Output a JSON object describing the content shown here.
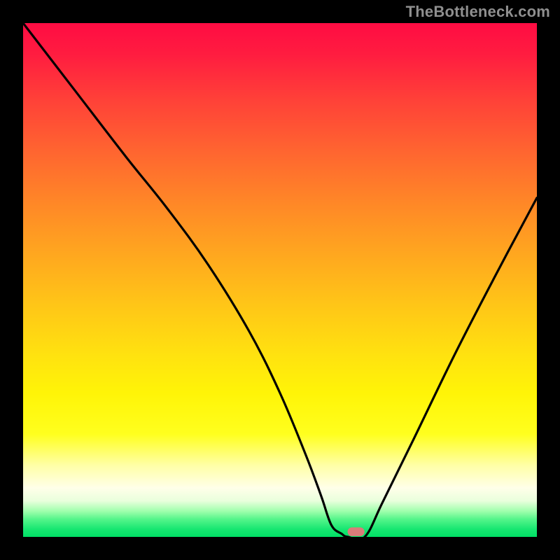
{
  "watermark": "TheBottleneck.com",
  "chart_data": {
    "type": "line",
    "title": "",
    "xlabel": "",
    "ylabel": "",
    "xlim": [
      0,
      100
    ],
    "ylim": [
      0,
      100
    ],
    "grid": false,
    "legend": false,
    "background": {
      "type": "vertical-gradient",
      "stops": [
        {
          "pos": 0.0,
          "color": "#ff0c43"
        },
        {
          "pos": 0.06,
          "color": "#ff1c40"
        },
        {
          "pos": 0.15,
          "color": "#ff4138"
        },
        {
          "pos": 0.25,
          "color": "#ff6530"
        },
        {
          "pos": 0.35,
          "color": "#ff8727"
        },
        {
          "pos": 0.45,
          "color": "#ffa71f"
        },
        {
          "pos": 0.55,
          "color": "#ffc617"
        },
        {
          "pos": 0.65,
          "color": "#ffe30f"
        },
        {
          "pos": 0.72,
          "color": "#fff407"
        },
        {
          "pos": 0.8,
          "color": "#ffff1e"
        },
        {
          "pos": 0.86,
          "color": "#ffffa5"
        },
        {
          "pos": 0.905,
          "color": "#ffffe9"
        },
        {
          "pos": 0.93,
          "color": "#e9ffdc"
        },
        {
          "pos": 0.95,
          "color": "#9fffac"
        },
        {
          "pos": 0.965,
          "color": "#57f58b"
        },
        {
          "pos": 0.985,
          "color": "#17e771"
        },
        {
          "pos": 1.0,
          "color": "#00e066"
        }
      ]
    },
    "series": [
      {
        "name": "bottleneck-curve",
        "x": [
          0,
          10,
          20,
          28,
          36,
          44,
          50,
          55,
          58,
          60,
          62,
          63.2,
          66.5,
          70,
          76,
          84,
          92,
          100
        ],
        "y": [
          100,
          87,
          74,
          64,
          53,
          40,
          28,
          16,
          8,
          2.3,
          0.6,
          0,
          0,
          6.8,
          19,
          35.5,
          51,
          66
        ]
      }
    ],
    "marker": {
      "name": "optimal-zone",
      "x": 64.8,
      "y": 1.0,
      "width": 3.3,
      "height": 1.7,
      "color": "#d97c79"
    }
  },
  "colors": {
    "frame": "#000000",
    "curve": "#000000",
    "marker": "#d97c79"
  }
}
